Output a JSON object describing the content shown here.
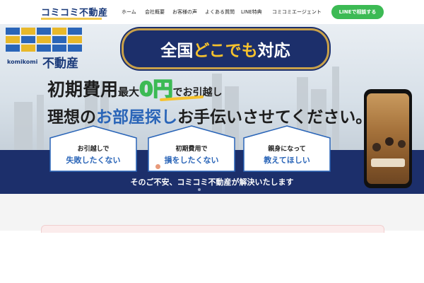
{
  "header": {
    "logo_text": "コミコミ不動産",
    "nav": [
      {
        "label": "ホーム"
      },
      {
        "label": "会社概要"
      },
      {
        "label": "お客様の声"
      },
      {
        "label": "よくある質問"
      },
      {
        "label": "LINE特典"
      },
      {
        "label": "コミコミエージェント"
      }
    ],
    "cta_label": "LINEで相談する"
  },
  "hero": {
    "logo_roman": "komikomi",
    "logo_kanji": "不動産",
    "banner": {
      "part1": "全国",
      "part2": "どこでも",
      "part3": "対応"
    },
    "cost": {
      "p1": "初期費用",
      "p2": "最大",
      "p3": "0円",
      "p4": "でお引越し"
    },
    "ideal": {
      "p1": "理想の",
      "p2": "お部屋探し",
      "p3": "お手伝いさせてください。"
    },
    "worries": [
      {
        "line1": "お引越しで",
        "line2": "失敗したくない"
      },
      {
        "line1": "初期費用で",
        "line2": "損をしたくない"
      },
      {
        "line1": "親身になって",
        "line2": "教えてほしい"
      }
    ],
    "tagline": "そのご不安、コミコミ不動産が解決いたします"
  },
  "colors": {
    "navy": "#1c2f6b",
    "blue": "#2a65b8",
    "green": "#3cba54",
    "yellow": "#f6c22d",
    "gold": "#c9a14a"
  }
}
